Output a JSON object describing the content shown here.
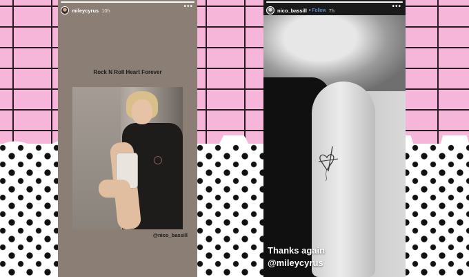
{
  "left_story": {
    "username": "mileycyrus",
    "time": "10h",
    "more": "•••",
    "shared_post_title": "Rock N Roll Heart Forever",
    "mention": "@nico_bassill"
  },
  "right_story": {
    "username": "nico_bassill",
    "separator": "•",
    "follow": "Follow",
    "time": "7h",
    "more": "•••",
    "caption_line1": "Thanks again",
    "caption_line2": "@mileycyrus"
  },
  "colors": {
    "brick_pink": "#f5b6da",
    "follow_blue": "#6fb3ff",
    "dot_black": "#111111"
  }
}
